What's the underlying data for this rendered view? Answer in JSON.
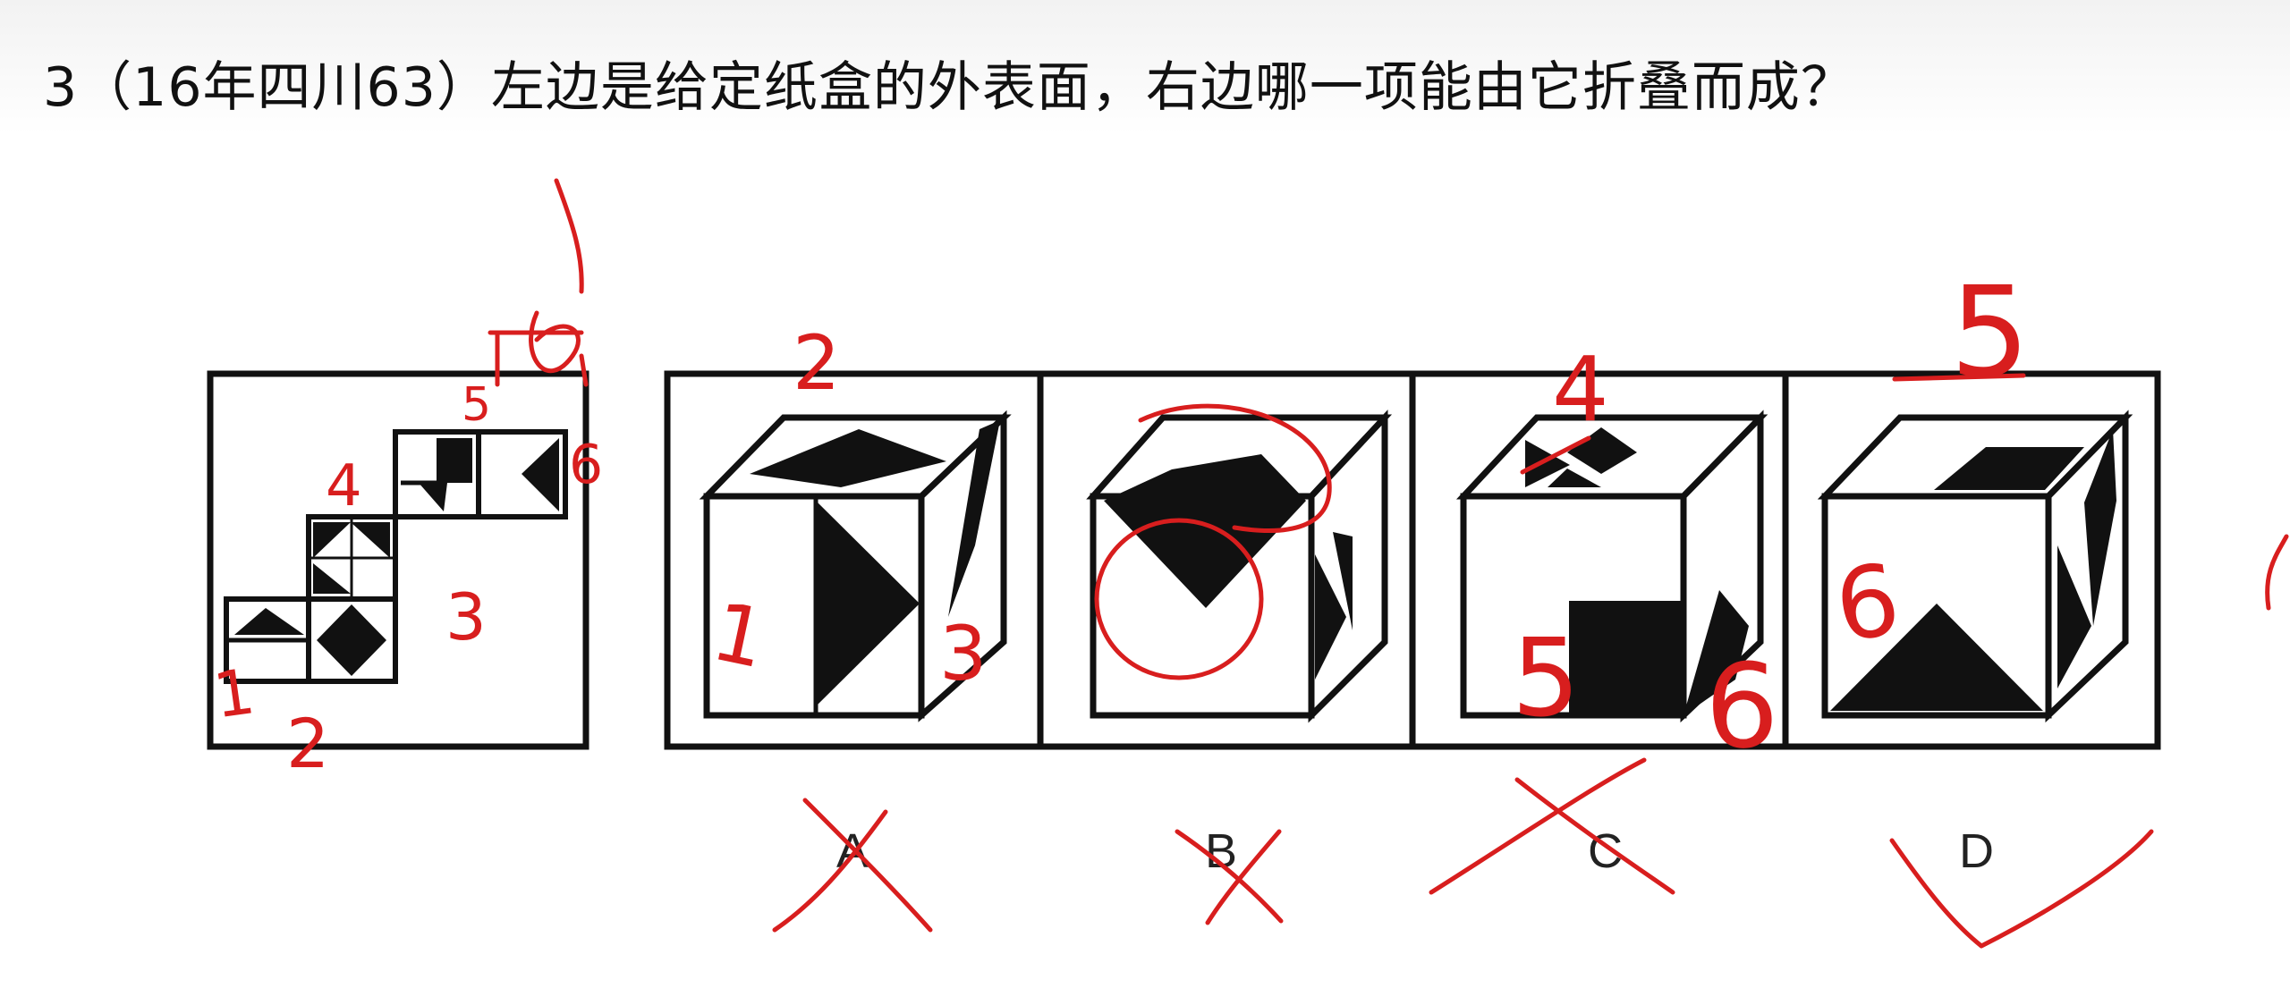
{
  "question": {
    "text": "3（16年四川63）左边是给定纸盒的外表面，右边哪一项能由它折叠而成？"
  },
  "options": {
    "a": "A",
    "b": "B",
    "c": "C",
    "d": "D"
  },
  "annotations": {
    "net_numbers": [
      "1",
      "2",
      "3",
      "4",
      "5",
      "6"
    ],
    "a_face_1": "1",
    "a_face_2": "2",
    "a_face_3": "3",
    "c_face_4": "4",
    "c_face_5": "5",
    "c_face_6": "6",
    "d_face_5": "5",
    "d_face_6": "6",
    "marks": {
      "a": "wrong",
      "b": "wrong",
      "c": "wrong",
      "d": "correct"
    }
  },
  "colors": {
    "ink": "#d81e1e",
    "line": "#111111"
  }
}
